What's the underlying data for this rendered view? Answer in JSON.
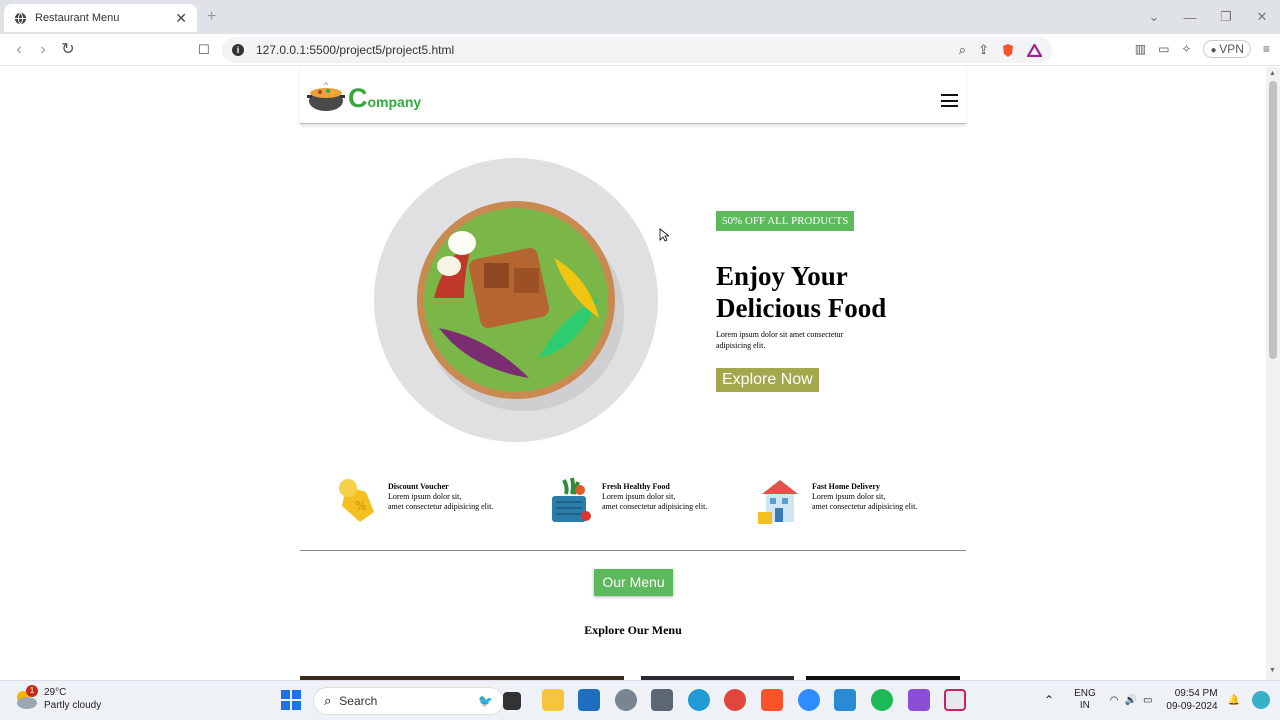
{
  "browser": {
    "tab_title": "Restaurant Menu",
    "url": "127.0.0.1:5500/project5/project5.html",
    "vpn_label": "VPN"
  },
  "site": {
    "logo_letter": "C",
    "logo_rest": "ompany",
    "badge": "50% OFF ALL PRODUCTS",
    "hero_title_line1": "Enjoy Your",
    "hero_title_line2": "Delicious Food",
    "hero_sub": "Lorem ipsum dolor sit amet consectetur adipisicing elit.",
    "explore_button": "Explore Now",
    "features": [
      {
        "title": "Discount Voucher",
        "line1": "Lorem ipsum dolor sit,",
        "line2": "amet consectetur adipisicing elit."
      },
      {
        "title": "Fresh Healthy Food",
        "line1": "Lorem ipsum dolor sit,",
        "line2": "amet consectetur adipisicing elit."
      },
      {
        "title": "Fast Home Delivery",
        "line1": "Lorem ipsum dolor sit,",
        "line2": "amet consectetur adipisicing elit."
      }
    ],
    "menu_button": "Our Menu",
    "explore_title": "Explore Our Menu"
  },
  "taskbar": {
    "temperature": "29°C",
    "weather": "Partly cloudy",
    "weather_badge": "1",
    "search_label": "Search",
    "lang_line1": "ENG",
    "lang_line2": "IN",
    "time": "09:54 PM",
    "date": "09-09-2024"
  },
  "colors": {
    "brand_green": "#35a83d",
    "badge_green": "#5cba5c",
    "explore_olive": "#a3a84c"
  }
}
